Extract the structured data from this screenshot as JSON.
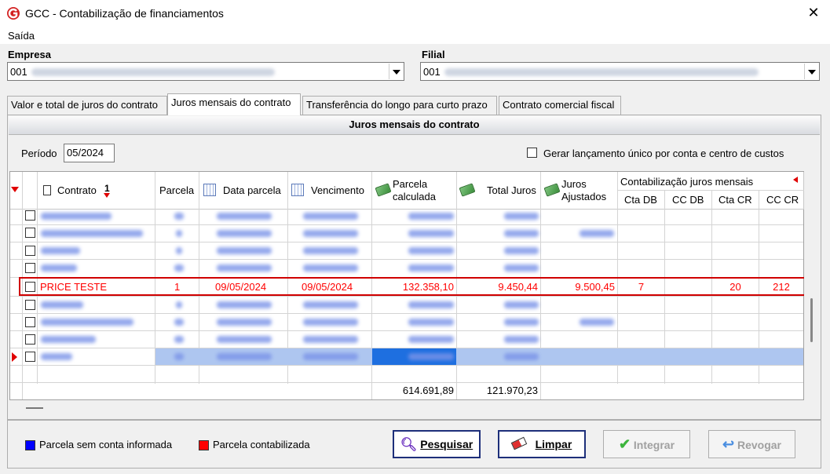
{
  "window": {
    "title": "GCC - Contabilização de financiamentos",
    "close": "✕"
  },
  "menu": {
    "saida": "Saída"
  },
  "empresa": {
    "label": "Empresa",
    "value": "001"
  },
  "filial": {
    "label": "Filial",
    "value": "001"
  },
  "tabs": [
    {
      "label": "Valor e total de juros do contrato"
    },
    {
      "label": "Juros mensais do contrato"
    },
    {
      "label": "Transferência do longo para curto prazo"
    },
    {
      "label": "Contrato comercial fiscal"
    }
  ],
  "panel": {
    "title": "Juros mensais do contrato"
  },
  "periodo": {
    "label": "Período",
    "value": "05/2024"
  },
  "gerar_lancamento": {
    "label": "Gerar lançamento único por conta e centro de custos"
  },
  "grid": {
    "headers": {
      "contrato": "Contrato",
      "sort_num": "1",
      "parcela": "Parcela",
      "data_parcela": "Data parcela",
      "vencimento": "Vencimento",
      "parcela_calculada_1": "Parcela",
      "parcela_calculada_2": "calculada",
      "total_juros": "Total Juros",
      "juros_ajustados_1": "Juros",
      "juros_ajustados_2": "Ajustados",
      "contabilizacao": "Contabilização juros mensais",
      "cta_db": "Cta DB",
      "cc_db": "CC DB",
      "cta_cr": "Cta CR",
      "cc_cr": "CC CR"
    },
    "highlighted_row": {
      "contrato": "PRICE TESTE",
      "parcela": "1",
      "data_parcela": "09/05/2024",
      "vencimento": "09/05/2024",
      "parcela_calculada": "132.358,10",
      "total_juros": "9.450,44",
      "juros_ajustados": "9.500,45",
      "cta_db": "7",
      "cc_db": "",
      "cta_cr": "20",
      "cc_cr": "212"
    },
    "totals": {
      "parcela_calculada": "614.691,89",
      "total_juros": "121.970,23"
    }
  },
  "legend": [
    {
      "label": "Parcela sem conta informada",
      "color": "#0000ff"
    },
    {
      "label": "Parcela contabilizada",
      "color": "#ff0000"
    }
  ],
  "buttons": {
    "pesquisar": "Pesquisar",
    "limpar": "Limpar",
    "integrar": "Integrar",
    "revogar": "Revogar"
  },
  "colors": {
    "accent": "#1d2f7a",
    "row_text": "#ff0000",
    "highlight_border": "#d00000",
    "selection": "#1e6fe0"
  }
}
